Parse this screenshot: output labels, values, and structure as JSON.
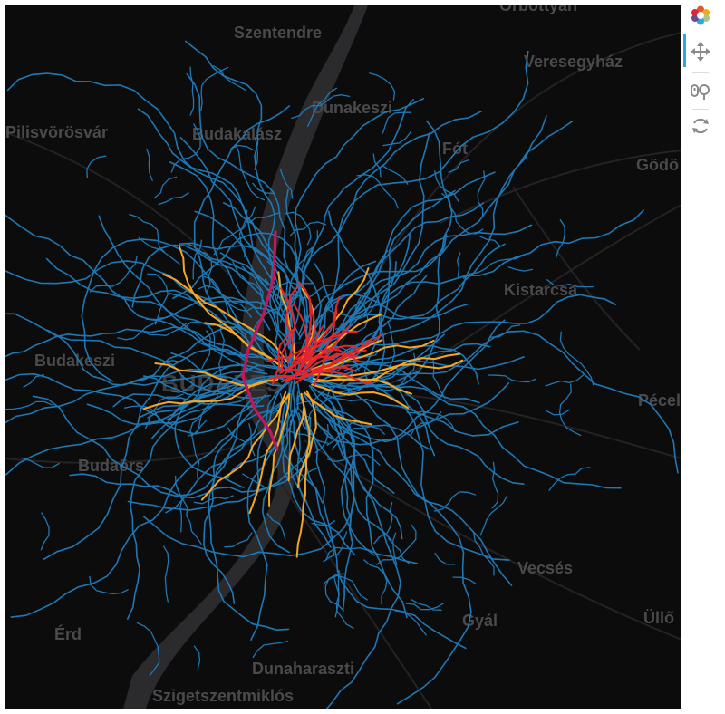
{
  "map": {
    "places": [
      {
        "id": "szentendre",
        "label": "Szentendre"
      },
      {
        "id": "orbottyan",
        "label": "Őrbottyán"
      },
      {
        "id": "veresegyhaz",
        "label": "Veresegyház"
      },
      {
        "id": "dunakeszi",
        "label": "Dunakeszi"
      },
      {
        "id": "pilisvorosvar",
        "label": "Pilisvörösvár"
      },
      {
        "id": "budakalasz",
        "label": "Budakalász"
      },
      {
        "id": "fot",
        "label": "Fót"
      },
      {
        "id": "godollo",
        "label": "Gödö"
      },
      {
        "id": "kistarcsa",
        "label": "Kistarcsa"
      },
      {
        "id": "budakeszi",
        "label": "Budakeszi"
      },
      {
        "id": "budapest",
        "label": "BUDAPEST"
      },
      {
        "id": "pecel",
        "label": "Pécel"
      },
      {
        "id": "budaors",
        "label": "Budaörs"
      },
      {
        "id": "vecses",
        "label": "Vecsés"
      },
      {
        "id": "erd",
        "label": "Érd"
      },
      {
        "id": "ocsa",
        "label": "Gyál"
      },
      {
        "id": "ulloi",
        "label": "Üllő"
      },
      {
        "id": "dunaharaszti",
        "label": "Dunaharaszti"
      },
      {
        "id": "szigetszentmiklos",
        "label": "Szigetszentmiklós"
      }
    ],
    "colors": {
      "background": "#0c0c0d",
      "river": "#2b2b2e",
      "roads": "#262629",
      "bus": "#1f78b4",
      "tram": "#f5a623",
      "trolleybus": "#e3262e",
      "metro": "#c2185b"
    }
  },
  "toolbar": {
    "logo": "bokeh-logo-icon",
    "tools": [
      {
        "name": "pan-tool",
        "icon": "move-arrows-icon",
        "active": true
      },
      {
        "name": "wheel-zoom-tool",
        "icon": "wheel-zoom-icon",
        "active": false
      },
      {
        "name": "reset-tool",
        "icon": "reset-icon",
        "active": false
      }
    ]
  }
}
